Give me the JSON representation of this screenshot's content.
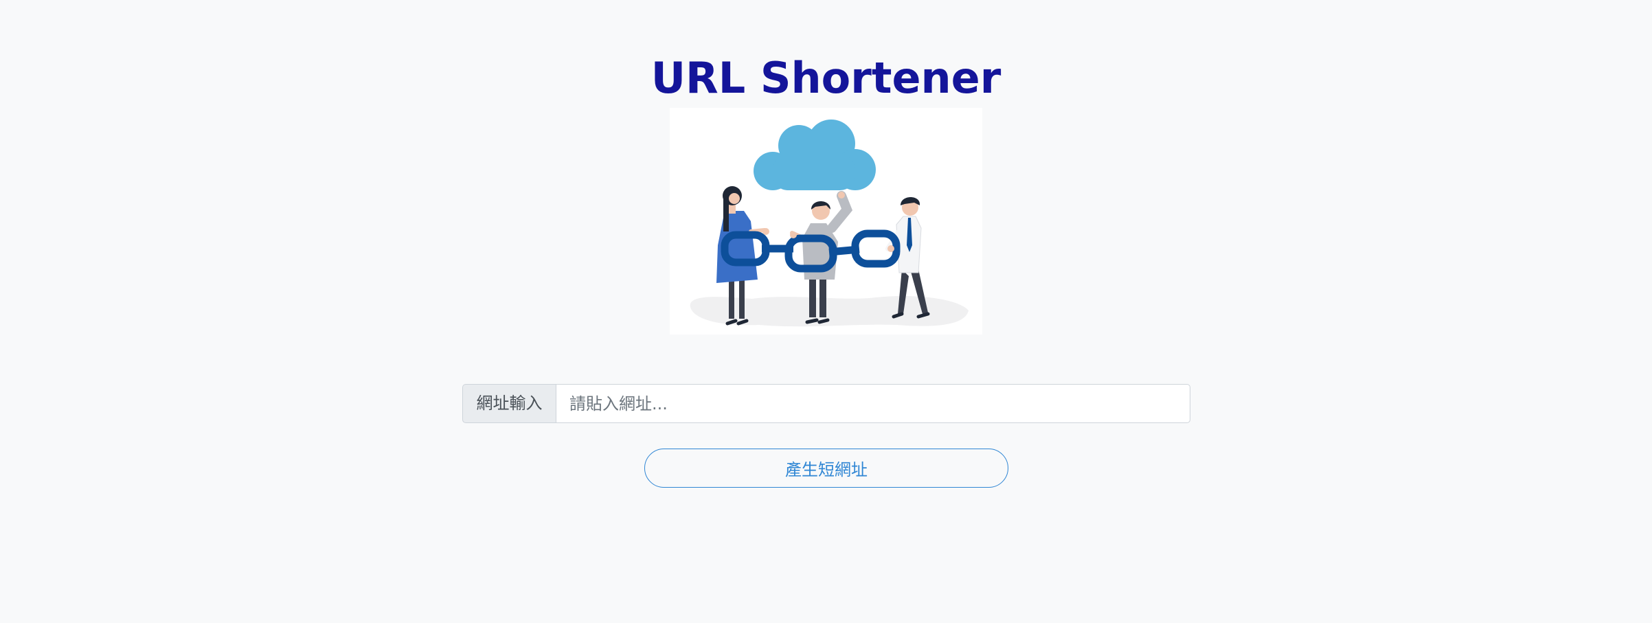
{
  "header": {
    "title": "URL Shortener"
  },
  "hero": {
    "illustration": "people-holding-chain-under-cloud"
  },
  "form": {
    "input_label": "網址輸入",
    "input_placeholder": "請貼入網址...",
    "input_value": "",
    "submit_label": "產生短網址"
  },
  "colors": {
    "page_background": "#f8f9fa",
    "title": "#14159a",
    "accent": "#2f86d4",
    "cloud": "#5cb5de",
    "chain": "#0d4f9a"
  }
}
